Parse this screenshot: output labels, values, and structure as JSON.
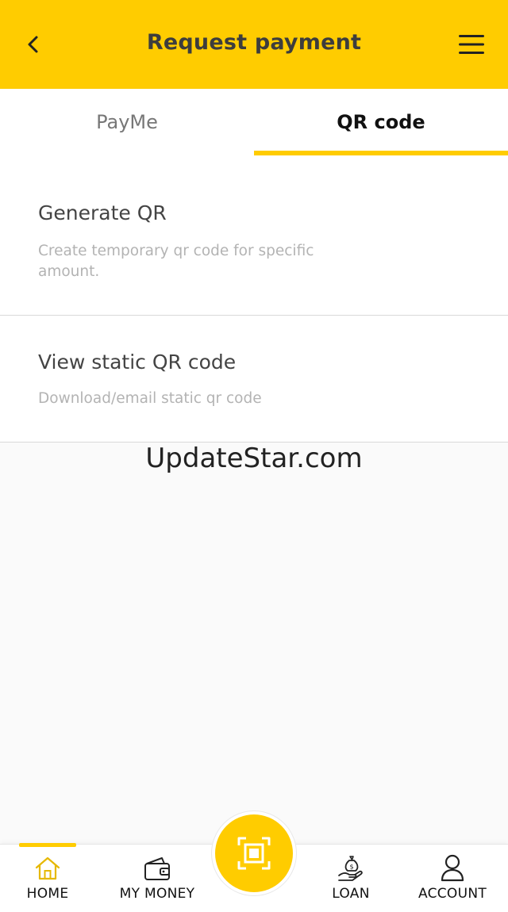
{
  "header": {
    "title": "Request payment",
    "back_icon": "chevron-left-icon",
    "menu_icon": "hamburger-menu-icon",
    "background_color": "#ffcc00"
  },
  "tabs": [
    {
      "label": "PayMe",
      "active": false
    },
    {
      "label": "QR code",
      "active": true
    }
  ],
  "options": [
    {
      "title": "Generate QR",
      "description": "Create temporary qr code for specific amount."
    },
    {
      "title": "View static QR code",
      "description": "Download/email static qr code"
    }
  ],
  "watermark": "UpdateStar.com",
  "bottom_nav": {
    "items": [
      {
        "label": "HOME",
        "icon": "home-icon",
        "active": true
      },
      {
        "label": "MY MONEY",
        "icon": "wallet-icon",
        "active": false
      },
      {
        "label": "LOAN",
        "icon": "money-bag-hand-icon",
        "active": false
      },
      {
        "label": "ACCOUNT",
        "icon": "user-icon",
        "active": false
      }
    ],
    "center_button_icon": "qr-scan-icon"
  },
  "colors": {
    "accent": "#ffcc00",
    "active_icon": "#e6b800"
  }
}
